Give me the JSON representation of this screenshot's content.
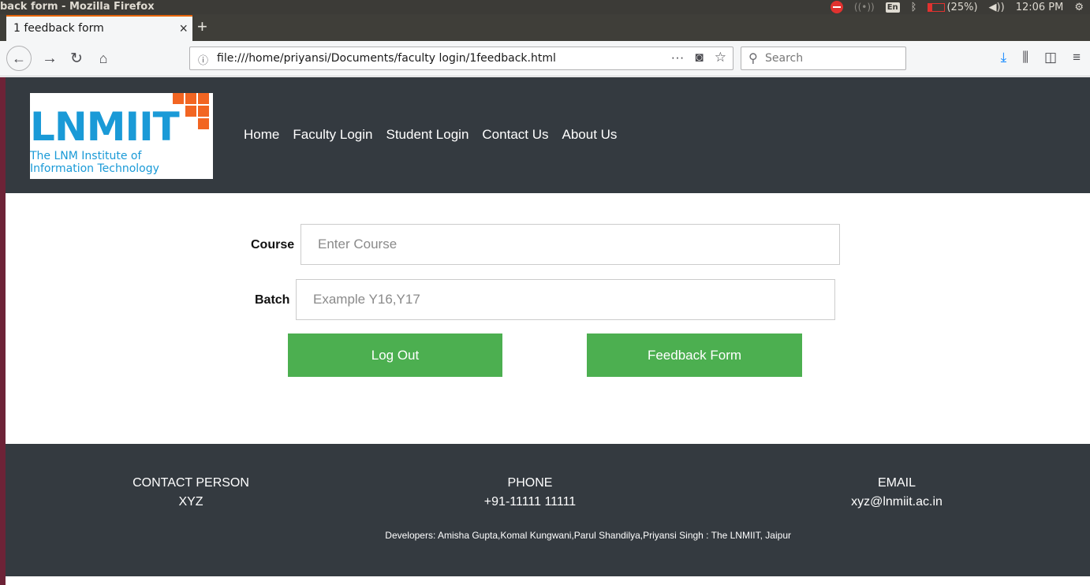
{
  "os": {
    "window_title": "back form - Mozilla Firefox",
    "lang": "En",
    "battery": "(25%)",
    "clock": "12:06 PM"
  },
  "browser": {
    "tab_title": "1 feedback form",
    "url": "file:///home/priyansi/Documents/faculty login/1feedback.html",
    "search_placeholder": "Search"
  },
  "site": {
    "logo_main": "LNMIIT",
    "logo_sub_1": "The LNM Institute of",
    "logo_sub_2": "Information Technology",
    "nav": [
      "Home",
      "Faculty Login",
      "Student Login",
      "Contact Us",
      "About Us"
    ]
  },
  "form": {
    "course_label": "Course",
    "course_placeholder": "Enter Course",
    "batch_label": "Batch",
    "batch_placeholder": "Example Y16,Y17",
    "logout_label": "Log Out",
    "feedback_label": "Feedback Form"
  },
  "footer": {
    "contact_heading": "CONTACT PERSON",
    "contact_value": "XYZ",
    "phone_heading": "PHONE",
    "phone_value": "+91-11111 11111",
    "email_heading": "EMAIL",
    "email_value": "xyz@lnmiit.ac.in",
    "developers": "Developers: Amisha Gupta,Komal Kungwani,Parul Shandilya,Priyansi Singh : The LNMIIT, Jaipur"
  },
  "colors": {
    "header_bg": "#343a40",
    "button_green": "#4caf50",
    "logo_blue": "#1a9ad7",
    "logo_orange": "#f26522"
  }
}
